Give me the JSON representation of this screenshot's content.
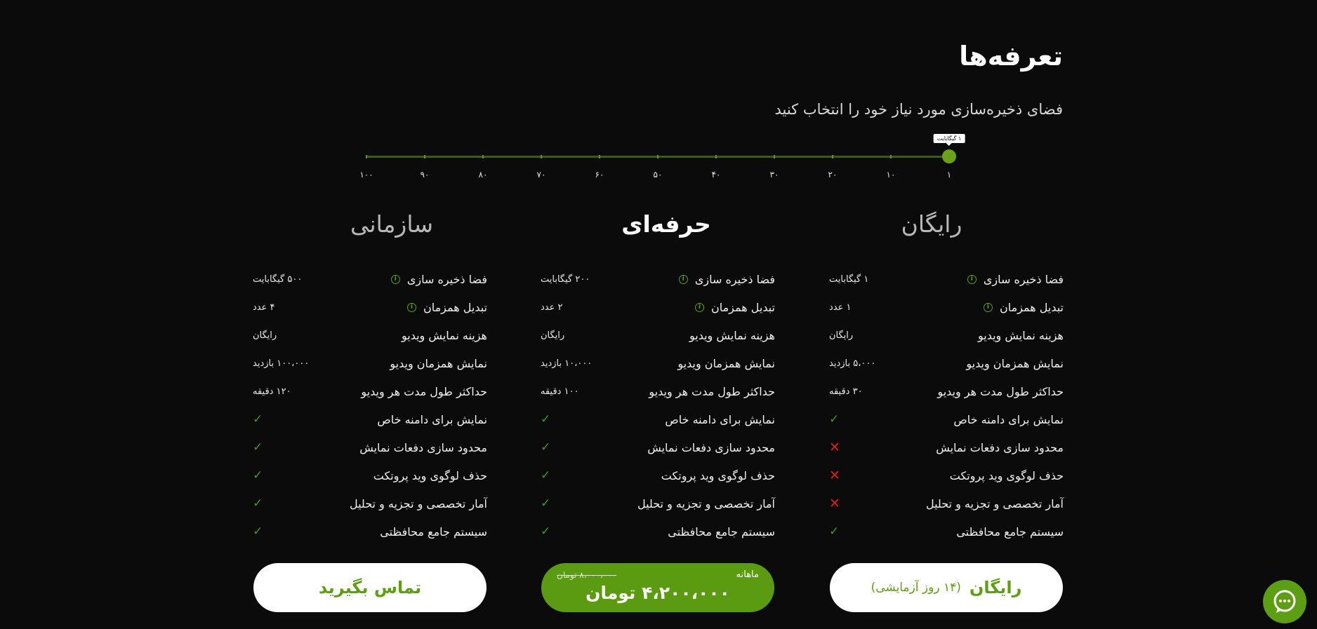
{
  "header": {
    "title": "تعرفه‌ها",
    "subtitle": "فضای ذخیره‌سازی مورد نیاز خود را انتخاب کنید"
  },
  "slider": {
    "tooltip": "۱ گیگابایت",
    "selected_value": 1,
    "ticks": [
      "۱",
      "۱۰",
      "۲۰",
      "۳۰",
      "۴۰",
      "۵۰",
      "۶۰",
      "۷۰",
      "۸۰",
      "۹۰",
      "۱۰۰"
    ]
  },
  "plans": [
    {
      "name": "رایگان",
      "rows": [
        {
          "label": "فضا ذخیره سازی",
          "value": "۱ گیگابایت",
          "info": true
        },
        {
          "label": "تبدیل همزمان",
          "value": "۱ عدد",
          "info": true
        },
        {
          "label": "هزینه نمایش ویدیو",
          "value": "رایگان"
        },
        {
          "label": "نمایش همزمان ویدیو",
          "value": "۵،۰۰۰ بازدید"
        },
        {
          "label": "حداکثر طول مدت هر ویدیو",
          "value": "۳۰ دقیقه"
        },
        {
          "label": "نمایش برای دامنه خاص",
          "icon": "check"
        },
        {
          "label": "محدود سازی دفعات نمایش",
          "icon": "cross"
        },
        {
          "label": "حذف لوگوی وید پروتکت",
          "icon": "cross"
        },
        {
          "label": "آمار تخصصی و تجزیه و تحلیل",
          "icon": "cross"
        },
        {
          "label": "سیستم جامع محافظتی",
          "icon": "check"
        }
      ],
      "cta": {
        "label": "رایگان",
        "note": "(۱۴ روز آزمایشی)"
      }
    },
    {
      "name": "حرفه‌ای",
      "rows": [
        {
          "label": "فضا ذخیره سازی",
          "value": "۲۰۰ گیگابایت",
          "info": true
        },
        {
          "label": "تبدیل همزمان",
          "value": "۲ عدد",
          "info": true
        },
        {
          "label": "هزینه نمایش ویدیو",
          "value": "رایگان"
        },
        {
          "label": "نمایش همزمان ویدیو",
          "value": "۱۰،۰۰۰ بازدید"
        },
        {
          "label": "حداکثر طول مدت هر ویدیو",
          "value": "۱۰۰ دقیقه"
        },
        {
          "label": "نمایش برای دامنه خاص",
          "icon": "check"
        },
        {
          "label": "محدود سازی دفعات نمایش",
          "icon": "check"
        },
        {
          "label": "حذف لوگوی وید پروتکت",
          "icon": "check"
        },
        {
          "label": "آمار تخصصی و تجزیه و تحلیل",
          "icon": "check"
        },
        {
          "label": "سیستم جامع محافظتی",
          "icon": "check"
        }
      ],
      "cta": {
        "period": "ماهانه",
        "old_price": "۸،۰۰۰،۰۰۰ تومان",
        "price": "۴،۲۰۰،۰۰۰ تومان"
      }
    },
    {
      "name": "سازمانی",
      "rows": [
        {
          "label": "فضا ذخیره سازی",
          "value": "۵۰۰ گیگابایت",
          "info": true
        },
        {
          "label": "تبدیل همزمان",
          "value": "۴ عدد",
          "info": true
        },
        {
          "label": "هزینه نمایش ویدیو",
          "value": "رایگان"
        },
        {
          "label": "نمایش همزمان ویدیو",
          "value": "۱۰۰،۰۰۰ بازدید"
        },
        {
          "label": "حداکثر طول مدت هر ویدیو",
          "value": "۱۲۰ دقیقه"
        },
        {
          "label": "نمایش برای دامنه خاص",
          "icon": "check"
        },
        {
          "label": "محدود سازی دفعات نمایش",
          "icon": "check"
        },
        {
          "label": "حذف لوگوی وید پروتکت",
          "icon": "check"
        },
        {
          "label": "آمار تخصصی و تجزیه و تحلیل",
          "icon": "check"
        },
        {
          "label": "سیستم جامع محافظتی",
          "icon": "check"
        }
      ],
      "cta": {
        "label": "تماس بگیرید"
      }
    }
  ],
  "chat": {
    "icon": "chat-bubble-icon"
  },
  "colors": {
    "accent": "#5a9b12",
    "background": "#0b0b0b",
    "check": "#3f9b16",
    "cross": "#d82020"
  }
}
